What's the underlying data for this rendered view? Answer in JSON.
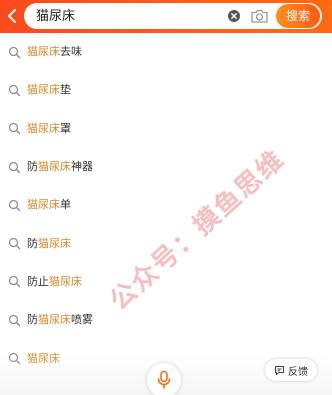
{
  "search": {
    "query": "猫尿床",
    "button_label": "搜索"
  },
  "suggestions": [
    {
      "prefix": "",
      "keyword": "猫尿床",
      "suffix": "去味"
    },
    {
      "prefix": "",
      "keyword": "猫尿床",
      "suffix": "垫"
    },
    {
      "prefix": "",
      "keyword": "猫尿床",
      "suffix": "罩"
    },
    {
      "prefix": "防",
      "keyword": "猫尿床",
      "suffix": "神器"
    },
    {
      "prefix": "",
      "keyword": "猫尿床",
      "suffix": "单"
    },
    {
      "prefix": "防",
      "keyword": "猫尿床",
      "suffix": ""
    },
    {
      "prefix": "防止",
      "keyword": "猫尿床",
      "suffix": ""
    },
    {
      "prefix": "防",
      "keyword": "猫尿床",
      "suffix": "喷雾"
    },
    {
      "prefix": "",
      "keyword": "猫尿床",
      "suffix": ""
    }
  ],
  "bottom": {
    "feedback_label": "反馈"
  },
  "watermark": {
    "text": "公众号：摸鱼思维"
  },
  "colors": {
    "header_start": "#fa4b1c",
    "header_end": "#ff6a13",
    "search_button": "#ff7a18",
    "keyword_highlight": "#d98a2a",
    "text": "#333333",
    "icon_gray": "#8a8a8a",
    "mic_orange": "#ff6a13",
    "watermark": "#e64646"
  },
  "icons": {
    "back": "chevron-left-icon",
    "clear": "clear-circle-icon",
    "camera": "camera-icon",
    "suggestion": "search-icon",
    "mic": "microphone-icon",
    "feedback": "feedback-icon"
  }
}
